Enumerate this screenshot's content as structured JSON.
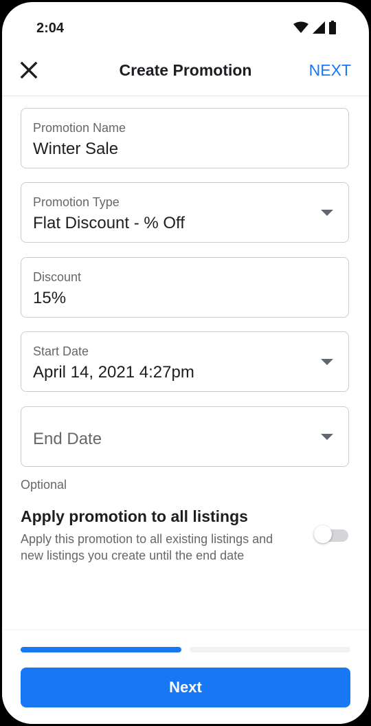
{
  "status_bar": {
    "time": "2:04"
  },
  "header": {
    "title": "Create Promotion",
    "next_label": "NEXT"
  },
  "form": {
    "fields": [
      {
        "label": "Promotion Name",
        "value": "Winter Sale"
      },
      {
        "label": "Promotion Type",
        "value": "Flat Discount - % Off"
      },
      {
        "label": "Discount",
        "value": "15%"
      },
      {
        "label": "Start Date",
        "value": "April 14, 2021 4:27pm"
      },
      {
        "placeholder": "End Date"
      }
    ],
    "end_date_helper": "Optional"
  },
  "apply_all": {
    "title": "Apply promotion to all listings",
    "description": "Apply this promotion to all existing listings and new listings you create until the end date",
    "enabled": false
  },
  "footer": {
    "progress": {
      "current_step": 1,
      "total_steps": 2
    },
    "button_label": "Next"
  },
  "colors": {
    "accent": "#1877f2",
    "text": "#1c1e21",
    "secondary_text": "#65676b",
    "border": "#c9ccd1"
  },
  "icons": [
    "close-icon",
    "wifi-icon",
    "signal-icon",
    "battery-icon",
    "dropdown-caret-icon"
  ]
}
